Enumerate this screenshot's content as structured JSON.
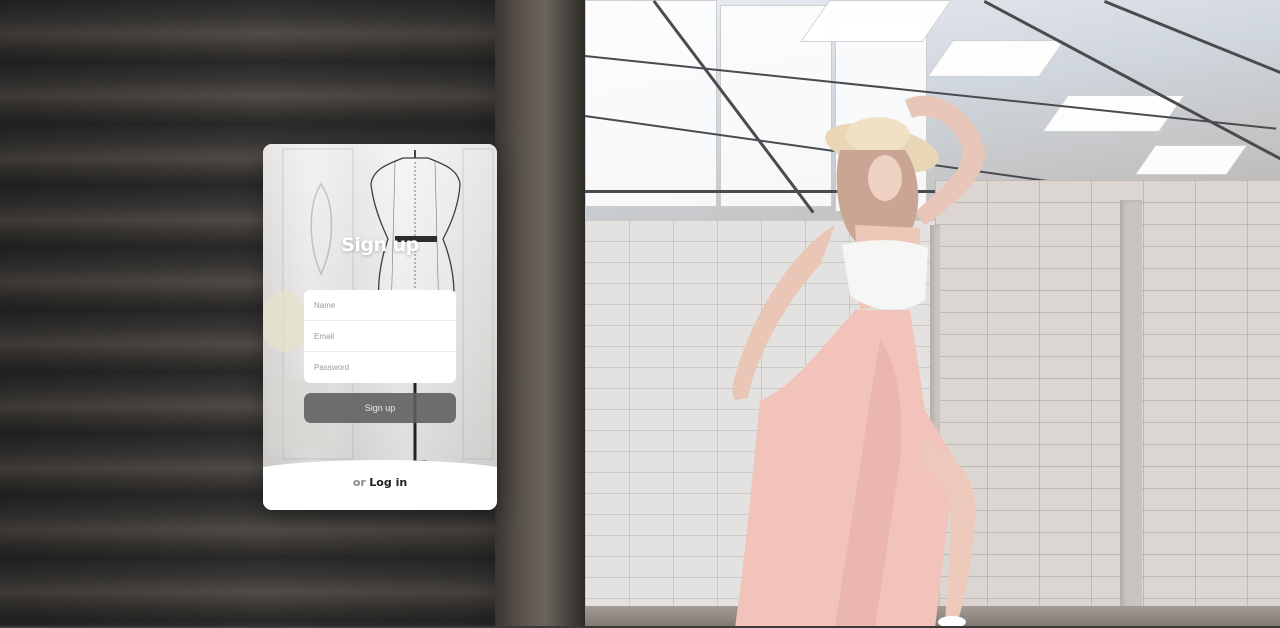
{
  "signup_card": {
    "title": "Sign up",
    "fields": {
      "name_placeholder": "Name",
      "email_placeholder": "Email",
      "password_placeholder": "Password"
    },
    "submit_label": "Sign up",
    "footer": {
      "or_text": "or",
      "login_link": "Log in"
    }
  },
  "colors": {
    "card_title": "#ffffff",
    "submit_button": "#5f5d5c",
    "footer_link": "#1f1f1f",
    "footer_or": "#8a8a8a"
  }
}
